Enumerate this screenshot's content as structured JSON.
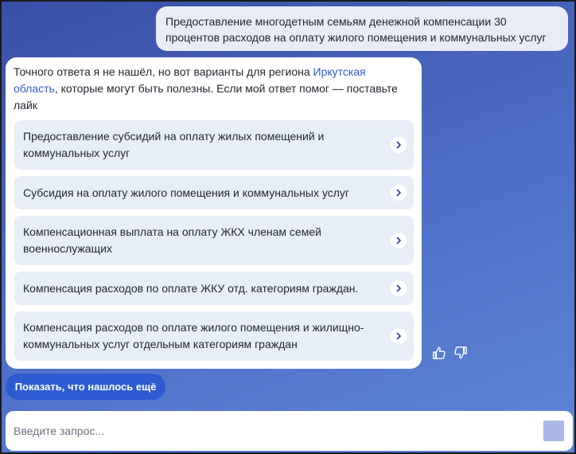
{
  "user_message": {
    "text": "Предоставление многодетным семьям денежной компенсации 30 процентов расходов на оплату жилого помещения и коммунальных услуг"
  },
  "bot_message": {
    "text_before": "Точного ответа я не нашёл, но вот варианты для региона ",
    "region_link": "Иркутская область",
    "text_after": ", которые могут быть полезны. Если мой ответ помог — поставьте лайк",
    "options": [
      {
        "label": "Предоставление субсидий на оплату жилых помещений и коммунальных услуг"
      },
      {
        "label": "Субсидия на оплату жилого помещения и коммунальных услуг"
      },
      {
        "label": "Компенсационная выплата на оплату ЖКХ членам семей военнослужащих"
      },
      {
        "label": "Компенсация расходов по оплате ЖКУ отд. категориям граждан."
      },
      {
        "label": "Компенсация расходов по оплате жилого помещения и жилищно-коммунальных услуг отдельным категориям граждан"
      }
    ],
    "option_icon": "chevron-right-icon"
  },
  "feedback": {
    "like_icon": "thumbs-up-icon",
    "dislike_icon": "thumbs-down-icon"
  },
  "show_more": {
    "label": "Показать, что нашлось ещё"
  },
  "input": {
    "placeholder": "Введите запрос...",
    "value": ""
  },
  "colors": {
    "background": "#4f6fc8",
    "accent": "#2d5bd1",
    "option_bg": "#e8eef8",
    "user_bubble": "#e7ecf7"
  }
}
